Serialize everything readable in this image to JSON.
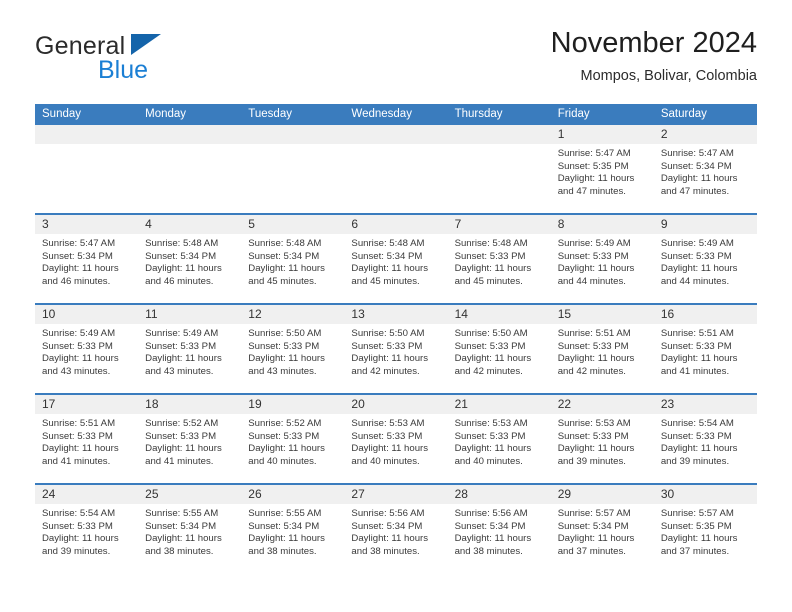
{
  "brand": {
    "word1": "General",
    "word2": "Blue",
    "triangle_color": "#1464aa",
    "blue_color": "#1b7fd4"
  },
  "header": {
    "title": "November 2024",
    "subtitle": "Mompos, Bolivar, Colombia"
  },
  "theme": {
    "header_blue": "#3a7cbe",
    "day_band_gray": "#f0f0f0",
    "text": "#3a3a3a"
  },
  "weekdays": [
    "Sunday",
    "Monday",
    "Tuesday",
    "Wednesday",
    "Thursday",
    "Friday",
    "Saturday"
  ],
  "weeks": [
    [
      {
        "day": "",
        "l1": "",
        "l2": "",
        "l3": "",
        "l4": ""
      },
      {
        "day": "",
        "l1": "",
        "l2": "",
        "l3": "",
        "l4": ""
      },
      {
        "day": "",
        "l1": "",
        "l2": "",
        "l3": "",
        "l4": ""
      },
      {
        "day": "",
        "l1": "",
        "l2": "",
        "l3": "",
        "l4": ""
      },
      {
        "day": "",
        "l1": "",
        "l2": "",
        "l3": "",
        "l4": ""
      },
      {
        "day": "1",
        "l1": "Sunrise: 5:47 AM",
        "l2": "Sunset: 5:35 PM",
        "l3": "Daylight: 11 hours",
        "l4": "and 47 minutes."
      },
      {
        "day": "2",
        "l1": "Sunrise: 5:47 AM",
        "l2": "Sunset: 5:34 PM",
        "l3": "Daylight: 11 hours",
        "l4": "and 47 minutes."
      }
    ],
    [
      {
        "day": "3",
        "l1": "Sunrise: 5:47 AM",
        "l2": "Sunset: 5:34 PM",
        "l3": "Daylight: 11 hours",
        "l4": "and 46 minutes."
      },
      {
        "day": "4",
        "l1": "Sunrise: 5:48 AM",
        "l2": "Sunset: 5:34 PM",
        "l3": "Daylight: 11 hours",
        "l4": "and 46 minutes."
      },
      {
        "day": "5",
        "l1": "Sunrise: 5:48 AM",
        "l2": "Sunset: 5:34 PM",
        "l3": "Daylight: 11 hours",
        "l4": "and 45 minutes."
      },
      {
        "day": "6",
        "l1": "Sunrise: 5:48 AM",
        "l2": "Sunset: 5:34 PM",
        "l3": "Daylight: 11 hours",
        "l4": "and 45 minutes."
      },
      {
        "day": "7",
        "l1": "Sunrise: 5:48 AM",
        "l2": "Sunset: 5:33 PM",
        "l3": "Daylight: 11 hours",
        "l4": "and 45 minutes."
      },
      {
        "day": "8",
        "l1": "Sunrise: 5:49 AM",
        "l2": "Sunset: 5:33 PM",
        "l3": "Daylight: 11 hours",
        "l4": "and 44 minutes."
      },
      {
        "day": "9",
        "l1": "Sunrise: 5:49 AM",
        "l2": "Sunset: 5:33 PM",
        "l3": "Daylight: 11 hours",
        "l4": "and 44 minutes."
      }
    ],
    [
      {
        "day": "10",
        "l1": "Sunrise: 5:49 AM",
        "l2": "Sunset: 5:33 PM",
        "l3": "Daylight: 11 hours",
        "l4": "and 43 minutes."
      },
      {
        "day": "11",
        "l1": "Sunrise: 5:49 AM",
        "l2": "Sunset: 5:33 PM",
        "l3": "Daylight: 11 hours",
        "l4": "and 43 minutes."
      },
      {
        "day": "12",
        "l1": "Sunrise: 5:50 AM",
        "l2": "Sunset: 5:33 PM",
        "l3": "Daylight: 11 hours",
        "l4": "and 43 minutes."
      },
      {
        "day": "13",
        "l1": "Sunrise: 5:50 AM",
        "l2": "Sunset: 5:33 PM",
        "l3": "Daylight: 11 hours",
        "l4": "and 42 minutes."
      },
      {
        "day": "14",
        "l1": "Sunrise: 5:50 AM",
        "l2": "Sunset: 5:33 PM",
        "l3": "Daylight: 11 hours",
        "l4": "and 42 minutes."
      },
      {
        "day": "15",
        "l1": "Sunrise: 5:51 AM",
        "l2": "Sunset: 5:33 PM",
        "l3": "Daylight: 11 hours",
        "l4": "and 42 minutes."
      },
      {
        "day": "16",
        "l1": "Sunrise: 5:51 AM",
        "l2": "Sunset: 5:33 PM",
        "l3": "Daylight: 11 hours",
        "l4": "and 41 minutes."
      }
    ],
    [
      {
        "day": "17",
        "l1": "Sunrise: 5:51 AM",
        "l2": "Sunset: 5:33 PM",
        "l3": "Daylight: 11 hours",
        "l4": "and 41 minutes."
      },
      {
        "day": "18",
        "l1": "Sunrise: 5:52 AM",
        "l2": "Sunset: 5:33 PM",
        "l3": "Daylight: 11 hours",
        "l4": "and 41 minutes."
      },
      {
        "day": "19",
        "l1": "Sunrise: 5:52 AM",
        "l2": "Sunset: 5:33 PM",
        "l3": "Daylight: 11 hours",
        "l4": "and 40 minutes."
      },
      {
        "day": "20",
        "l1": "Sunrise: 5:53 AM",
        "l2": "Sunset: 5:33 PM",
        "l3": "Daylight: 11 hours",
        "l4": "and 40 minutes."
      },
      {
        "day": "21",
        "l1": "Sunrise: 5:53 AM",
        "l2": "Sunset: 5:33 PM",
        "l3": "Daylight: 11 hours",
        "l4": "and 40 minutes."
      },
      {
        "day": "22",
        "l1": "Sunrise: 5:53 AM",
        "l2": "Sunset: 5:33 PM",
        "l3": "Daylight: 11 hours",
        "l4": "and 39 minutes."
      },
      {
        "day": "23",
        "l1": "Sunrise: 5:54 AM",
        "l2": "Sunset: 5:33 PM",
        "l3": "Daylight: 11 hours",
        "l4": "and 39 minutes."
      }
    ],
    [
      {
        "day": "24",
        "l1": "Sunrise: 5:54 AM",
        "l2": "Sunset: 5:33 PM",
        "l3": "Daylight: 11 hours",
        "l4": "and 39 minutes."
      },
      {
        "day": "25",
        "l1": "Sunrise: 5:55 AM",
        "l2": "Sunset: 5:34 PM",
        "l3": "Daylight: 11 hours",
        "l4": "and 38 minutes."
      },
      {
        "day": "26",
        "l1": "Sunrise: 5:55 AM",
        "l2": "Sunset: 5:34 PM",
        "l3": "Daylight: 11 hours",
        "l4": "and 38 minutes."
      },
      {
        "day": "27",
        "l1": "Sunrise: 5:56 AM",
        "l2": "Sunset: 5:34 PM",
        "l3": "Daylight: 11 hours",
        "l4": "and 38 minutes."
      },
      {
        "day": "28",
        "l1": "Sunrise: 5:56 AM",
        "l2": "Sunset: 5:34 PM",
        "l3": "Daylight: 11 hours",
        "l4": "and 38 minutes."
      },
      {
        "day": "29",
        "l1": "Sunrise: 5:57 AM",
        "l2": "Sunset: 5:34 PM",
        "l3": "Daylight: 11 hours",
        "l4": "and 37 minutes."
      },
      {
        "day": "30",
        "l1": "Sunrise: 5:57 AM",
        "l2": "Sunset: 5:35 PM",
        "l3": "Daylight: 11 hours",
        "l4": "and 37 minutes."
      }
    ]
  ]
}
